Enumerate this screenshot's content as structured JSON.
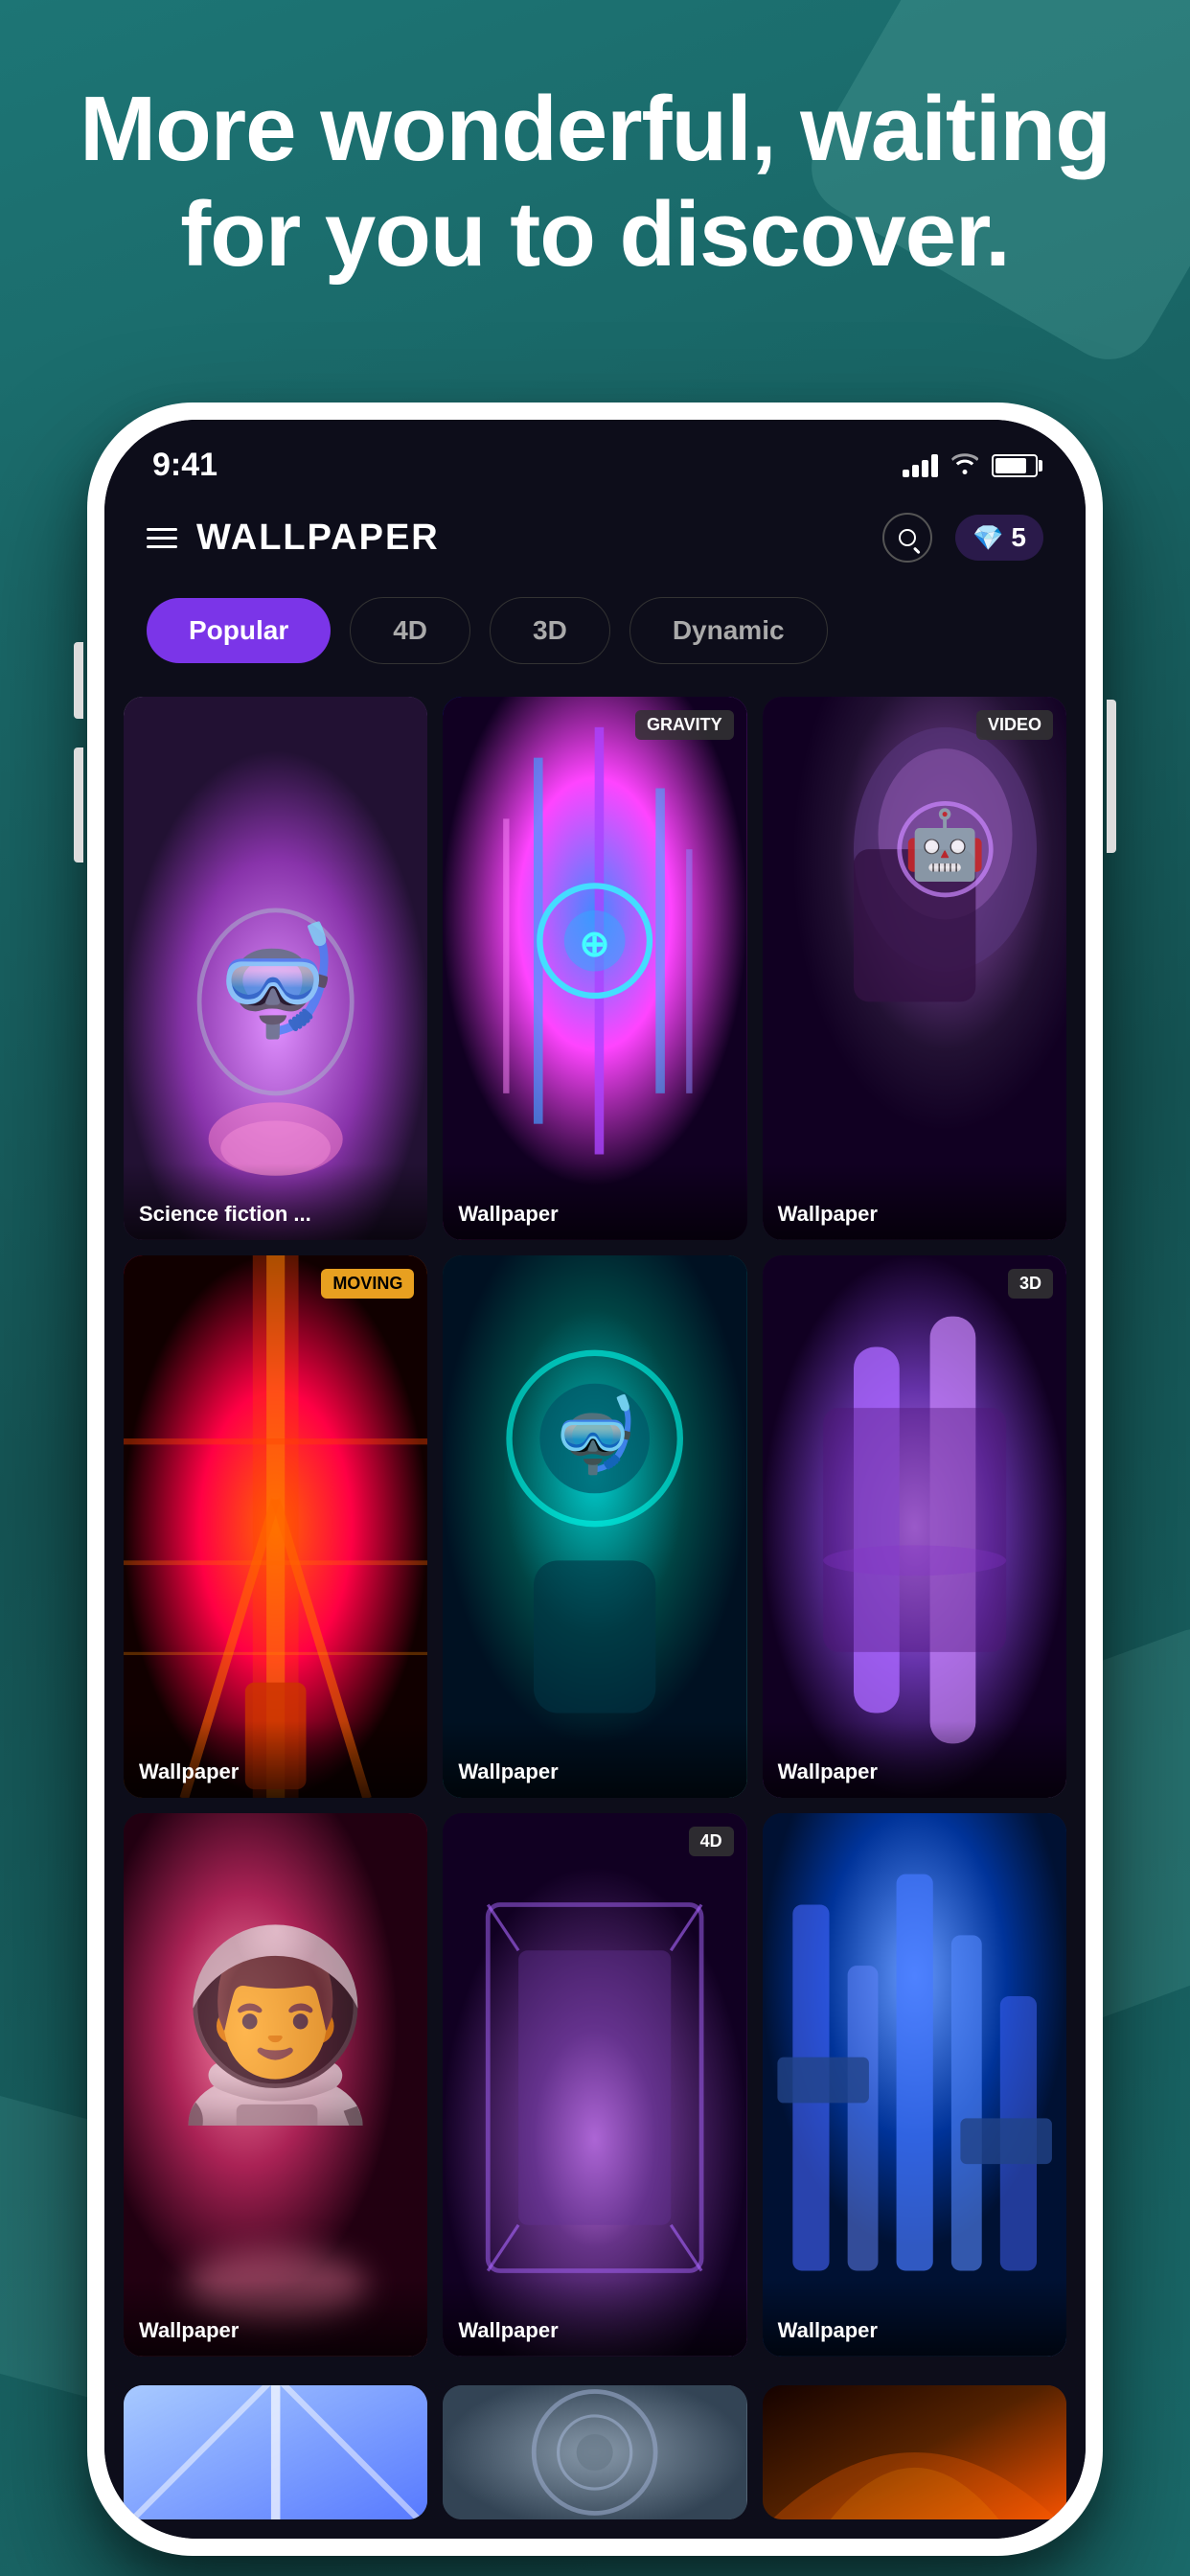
{
  "background": {
    "color": "#1a6b6b"
  },
  "hero": {
    "text": "More wonderful, waiting for you to discover."
  },
  "status_bar": {
    "time": "9:41",
    "signal": "full",
    "wifi": "on",
    "battery": "80"
  },
  "app_header": {
    "title": "WALLPAPER",
    "gems_count": "5"
  },
  "filter_tabs": {
    "tabs": [
      {
        "label": "Popular",
        "active": true
      },
      {
        "label": "4D",
        "active": false
      },
      {
        "label": "3D",
        "active": false
      },
      {
        "label": "Dynamic",
        "active": false
      }
    ]
  },
  "wallpapers": [
    {
      "id": 1,
      "name": "Science fiction ...",
      "badge": null,
      "gradient": "wp-1"
    },
    {
      "id": 2,
      "name": "Wallpaper",
      "badge": "GRAVITY",
      "badge_type": "gravity",
      "gradient": "wp-2"
    },
    {
      "id": 3,
      "name": "Wallpaper",
      "badge": "VIDEO",
      "badge_type": "video",
      "gradient": "wp-3"
    },
    {
      "id": 4,
      "name": "Wallpaper",
      "badge": "MOVING",
      "badge_type": "moving",
      "gradient": "wp-4"
    },
    {
      "id": 5,
      "name": "Wallpaper",
      "badge": null,
      "gradient": "wp-5"
    },
    {
      "id": 6,
      "name": "Wallpaper",
      "badge": "3D",
      "badge_type": "3d",
      "gradient": "wp-6"
    },
    {
      "id": 7,
      "name": "Wallpaper",
      "badge": null,
      "gradient": "wp-7"
    },
    {
      "id": 8,
      "name": "Wallpaper",
      "badge": "4D",
      "badge_type": "4d",
      "gradient": "wp-8"
    },
    {
      "id": 9,
      "name": "Wallpaper",
      "badge": null,
      "gradient": "wp-9"
    }
  ],
  "partial_wallpapers": [
    {
      "id": 10,
      "gradient": "partial-wp-1"
    },
    {
      "id": 11,
      "gradient": "partial-wp-2"
    },
    {
      "id": 12,
      "gradient": "partial-wp-3"
    }
  ]
}
